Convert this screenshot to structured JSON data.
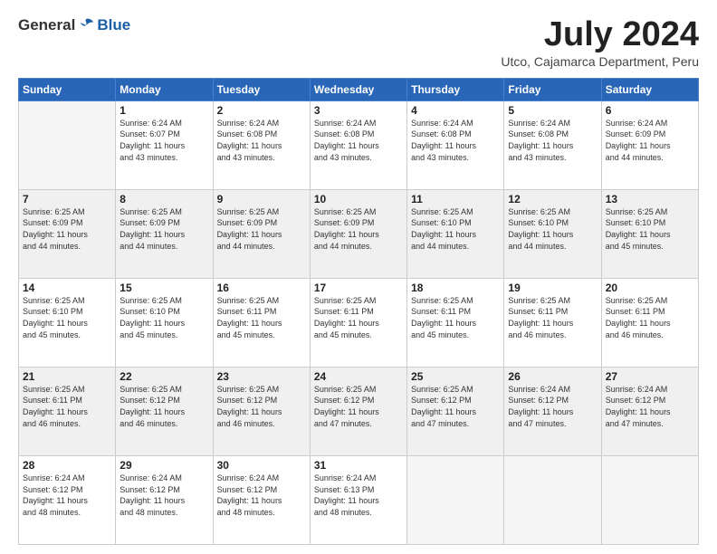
{
  "logo": {
    "general": "General",
    "blue": "Blue"
  },
  "header": {
    "month": "July 2024",
    "location": "Utco, Cajamarca Department, Peru"
  },
  "days_of_week": [
    "Sunday",
    "Monday",
    "Tuesday",
    "Wednesday",
    "Thursday",
    "Friday",
    "Saturday"
  ],
  "weeks": [
    [
      {
        "num": "",
        "info": ""
      },
      {
        "num": "1",
        "info": "Sunrise: 6:24 AM\nSunset: 6:07 PM\nDaylight: 11 hours\nand 43 minutes."
      },
      {
        "num": "2",
        "info": "Sunrise: 6:24 AM\nSunset: 6:08 PM\nDaylight: 11 hours\nand 43 minutes."
      },
      {
        "num": "3",
        "info": "Sunrise: 6:24 AM\nSunset: 6:08 PM\nDaylight: 11 hours\nand 43 minutes."
      },
      {
        "num": "4",
        "info": "Sunrise: 6:24 AM\nSunset: 6:08 PM\nDaylight: 11 hours\nand 43 minutes."
      },
      {
        "num": "5",
        "info": "Sunrise: 6:24 AM\nSunset: 6:08 PM\nDaylight: 11 hours\nand 43 minutes."
      },
      {
        "num": "6",
        "info": "Sunrise: 6:24 AM\nSunset: 6:09 PM\nDaylight: 11 hours\nand 44 minutes."
      }
    ],
    [
      {
        "num": "7",
        "info": "Sunrise: 6:25 AM\nSunset: 6:09 PM\nDaylight: 11 hours\nand 44 minutes."
      },
      {
        "num": "8",
        "info": "Sunrise: 6:25 AM\nSunset: 6:09 PM\nDaylight: 11 hours\nand 44 minutes."
      },
      {
        "num": "9",
        "info": "Sunrise: 6:25 AM\nSunset: 6:09 PM\nDaylight: 11 hours\nand 44 minutes."
      },
      {
        "num": "10",
        "info": "Sunrise: 6:25 AM\nSunset: 6:09 PM\nDaylight: 11 hours\nand 44 minutes."
      },
      {
        "num": "11",
        "info": "Sunrise: 6:25 AM\nSunset: 6:10 PM\nDaylight: 11 hours\nand 44 minutes."
      },
      {
        "num": "12",
        "info": "Sunrise: 6:25 AM\nSunset: 6:10 PM\nDaylight: 11 hours\nand 44 minutes."
      },
      {
        "num": "13",
        "info": "Sunrise: 6:25 AM\nSunset: 6:10 PM\nDaylight: 11 hours\nand 45 minutes."
      }
    ],
    [
      {
        "num": "14",
        "info": "Sunrise: 6:25 AM\nSunset: 6:10 PM\nDaylight: 11 hours\nand 45 minutes."
      },
      {
        "num": "15",
        "info": "Sunrise: 6:25 AM\nSunset: 6:10 PM\nDaylight: 11 hours\nand 45 minutes."
      },
      {
        "num": "16",
        "info": "Sunrise: 6:25 AM\nSunset: 6:11 PM\nDaylight: 11 hours\nand 45 minutes."
      },
      {
        "num": "17",
        "info": "Sunrise: 6:25 AM\nSunset: 6:11 PM\nDaylight: 11 hours\nand 45 minutes."
      },
      {
        "num": "18",
        "info": "Sunrise: 6:25 AM\nSunset: 6:11 PM\nDaylight: 11 hours\nand 45 minutes."
      },
      {
        "num": "19",
        "info": "Sunrise: 6:25 AM\nSunset: 6:11 PM\nDaylight: 11 hours\nand 46 minutes."
      },
      {
        "num": "20",
        "info": "Sunrise: 6:25 AM\nSunset: 6:11 PM\nDaylight: 11 hours\nand 46 minutes."
      }
    ],
    [
      {
        "num": "21",
        "info": "Sunrise: 6:25 AM\nSunset: 6:11 PM\nDaylight: 11 hours\nand 46 minutes."
      },
      {
        "num": "22",
        "info": "Sunrise: 6:25 AM\nSunset: 6:12 PM\nDaylight: 11 hours\nand 46 minutes."
      },
      {
        "num": "23",
        "info": "Sunrise: 6:25 AM\nSunset: 6:12 PM\nDaylight: 11 hours\nand 46 minutes."
      },
      {
        "num": "24",
        "info": "Sunrise: 6:25 AM\nSunset: 6:12 PM\nDaylight: 11 hours\nand 47 minutes."
      },
      {
        "num": "25",
        "info": "Sunrise: 6:25 AM\nSunset: 6:12 PM\nDaylight: 11 hours\nand 47 minutes."
      },
      {
        "num": "26",
        "info": "Sunrise: 6:24 AM\nSunset: 6:12 PM\nDaylight: 11 hours\nand 47 minutes."
      },
      {
        "num": "27",
        "info": "Sunrise: 6:24 AM\nSunset: 6:12 PM\nDaylight: 11 hours\nand 47 minutes."
      }
    ],
    [
      {
        "num": "28",
        "info": "Sunrise: 6:24 AM\nSunset: 6:12 PM\nDaylight: 11 hours\nand 48 minutes."
      },
      {
        "num": "29",
        "info": "Sunrise: 6:24 AM\nSunset: 6:12 PM\nDaylight: 11 hours\nand 48 minutes."
      },
      {
        "num": "30",
        "info": "Sunrise: 6:24 AM\nSunset: 6:12 PM\nDaylight: 11 hours\nand 48 minutes."
      },
      {
        "num": "31",
        "info": "Sunrise: 6:24 AM\nSunset: 6:13 PM\nDaylight: 11 hours\nand 48 minutes."
      },
      {
        "num": "",
        "info": ""
      },
      {
        "num": "",
        "info": ""
      },
      {
        "num": "",
        "info": ""
      }
    ]
  ]
}
